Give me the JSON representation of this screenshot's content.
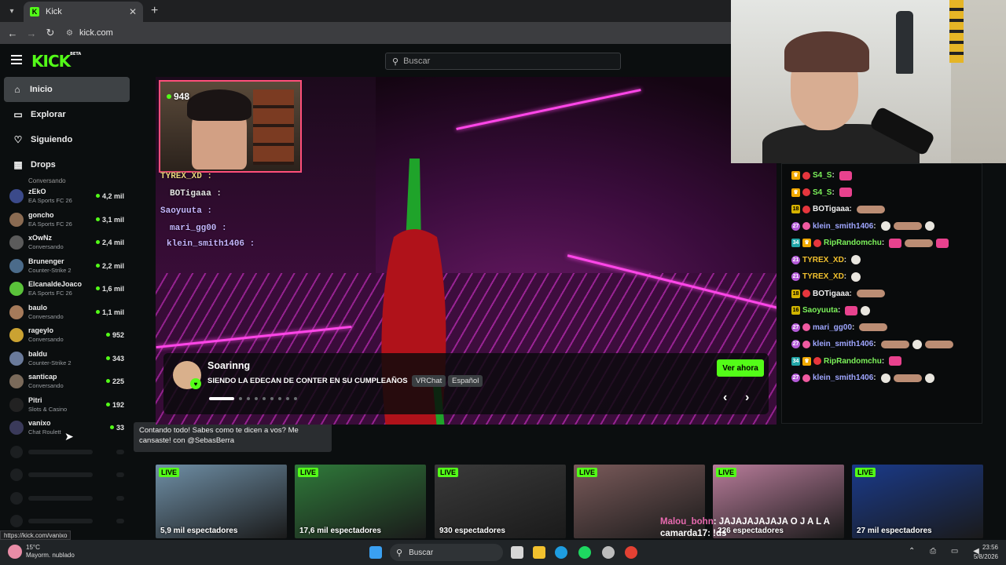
{
  "browser": {
    "tab_title": "Kick",
    "tab_favicon": "K",
    "url": "kick.com",
    "status_url": "https://kick.com/vanixo"
  },
  "header": {
    "logo": "KICK",
    "logo_badge": "BETA",
    "search_placeholder": "Buscar"
  },
  "sidebar": {
    "nav": [
      {
        "label": "Inicio",
        "icon": "home-icon"
      },
      {
        "label": "Explorar",
        "icon": "compass-icon"
      },
      {
        "label": "Siguiendo",
        "icon": "heart-icon"
      },
      {
        "label": "Drops",
        "icon": "drops-icon"
      }
    ],
    "cut_category": "Conversando",
    "channels": [
      {
        "name": "zEkO",
        "category": "EA Sports FC 26",
        "viewers": "4,2 mil",
        "color": "#3b4a8a"
      },
      {
        "name": "goncho",
        "category": "EA Sports FC 26",
        "viewers": "3,1 mil",
        "color": "#8a6b52"
      },
      {
        "name": "xOwNz",
        "category": "Conversando",
        "viewers": "2,4 mil",
        "color": "#5b5b5b"
      },
      {
        "name": "Brunenger",
        "category": "Counter-Strike 2",
        "viewers": "2,2 mil",
        "color": "#4b6b8a"
      },
      {
        "name": "ElcanaldeJoaco",
        "category": "EA Sports FC 26",
        "viewers": "1,6 mil",
        "color": "#5ac23a"
      },
      {
        "name": "baulo",
        "category": "Conversando",
        "viewers": "1,1 mil",
        "color": "#a57a5a"
      },
      {
        "name": "rageylo",
        "category": "Conversando",
        "viewers": "952",
        "color": "#caa232"
      },
      {
        "name": "baldu",
        "category": "Counter-Strike 2",
        "viewers": "343",
        "color": "#6a7a9a"
      },
      {
        "name": "santicap",
        "category": "Conversando",
        "viewers": "225",
        "color": "#7a6a5a"
      },
      {
        "name": "Pitri",
        "category": "Slots & Casino",
        "viewers": "192",
        "color": "#222222"
      },
      {
        "name": "vanixo",
        "category": "Chat Roulett",
        "viewers": "33",
        "color": "#3a3a5a"
      }
    ],
    "tooltip": "Contando todo! Sabes como te dicen a vos? Me cansaste! con @SebasBerra"
  },
  "featured": {
    "viewers": "948",
    "streamer": "Soarinng",
    "title": "SIENDO LA EDECAN DE CONTER EN SU CUMPLEAÑOS",
    "tags": [
      "VRChat",
      "Español"
    ],
    "cta": "Ver ahora",
    "overlay_chat": [
      {
        "user": "TYREX_XD :",
        "color": "#e6d37a"
      },
      {
        "user": "BOTigaaa :",
        "color": "#e6e6e6"
      },
      {
        "user": "Saoyuuta :",
        "color": "#c6b6ff"
      },
      {
        "user": "mari_gg00 :",
        "color": "#c6b6ff"
      },
      {
        "user": "klein_smith1406 :",
        "color": "#c6b6ff"
      }
    ]
  },
  "chat": {
    "lines": [
      {
        "badges": [
          "crown",
          "strawberry"
        ],
        "user": "S4_S",
        "color": "green",
        "emotes": [
          "pink"
        ]
      },
      {
        "badges": [
          "crown",
          "strawberry"
        ],
        "user": "S4_S",
        "color": "green",
        "emotes": [
          "pink"
        ]
      },
      {
        "badges": [
          "18",
          "strawberry"
        ],
        "user": "BOTigaaa",
        "color": "white",
        "emotes": [
          "tan"
        ]
      },
      {
        "badges": [
          "27",
          "pink"
        ],
        "user": "klein_smith1406",
        "color": "blue",
        "emotes": [
          "white",
          "tan",
          "white"
        ]
      },
      {
        "badges": [
          "34",
          "crown",
          "strawberry"
        ],
        "user": "RipRandomchu",
        "color": "green",
        "emotes": [
          "pink",
          "tan",
          "pink"
        ]
      },
      {
        "badges": [
          "21"
        ],
        "user": "TYREX_XD",
        "color": "yellow",
        "emotes": [
          "white"
        ]
      },
      {
        "badges": [
          "21"
        ],
        "user": "TYREX_XD",
        "color": "yellow",
        "emotes": [
          "white"
        ]
      },
      {
        "badges": [
          "18",
          "strawberry"
        ],
        "user": "BOTigaaa",
        "color": "white",
        "emotes": [
          "tan"
        ]
      },
      {
        "badges": [
          "16"
        ],
        "user": "Saoyuuta",
        "color": "green",
        "emotes": [
          "pink",
          "white"
        ]
      },
      {
        "badges": [
          "27",
          "pink"
        ],
        "user": "mari_gg00",
        "color": "blue",
        "emotes": [
          "tan"
        ]
      },
      {
        "badges": [
          "27",
          "pink"
        ],
        "user": "klein_smith1406",
        "color": "blue",
        "emotes": [
          "tan",
          "white",
          "tan"
        ]
      },
      {
        "badges": [
          "34",
          "crown",
          "strawberry"
        ],
        "user": "RipRandomchu",
        "color": "green",
        "emotes": [
          "pink"
        ]
      },
      {
        "badges": [
          "27",
          "pink"
        ],
        "user": "klein_smith1406",
        "color": "blue",
        "emotes": [
          "white",
          "tan",
          "white"
        ]
      }
    ]
  },
  "thumbnails": [
    {
      "live": "LIVE",
      "views": "5,9 mil espectadores",
      "bg": "#6f8fa6"
    },
    {
      "live": "LIVE",
      "views": "17,6 mil espectadores",
      "bg": "#2f7a3a"
    },
    {
      "live": "LIVE",
      "views": "930 espectadores",
      "bg": "#3a3a3a"
    },
    {
      "live": "LIVE",
      "views": "",
      "bg": "#7a5a5a"
    },
    {
      "live": "LIVE",
      "views": "226 espectadores",
      "bg": "#b87c9a"
    },
    {
      "live": "LIVE",
      "views": "27 mil espectadores",
      "bg": "#1a3a8a"
    }
  ],
  "overlay_chat_bottom": [
    {
      "user": "Malou_bohn",
      "text": ": JAJAJAJAJAJA O J A L A"
    },
    {
      "user": "camarda17",
      "text": ": !ds"
    }
  ],
  "taskbar": {
    "temp": "15°C",
    "weather": "Mayorm. nublado",
    "search": "Buscar",
    "time": "23:56",
    "date": "5/8/2026"
  }
}
